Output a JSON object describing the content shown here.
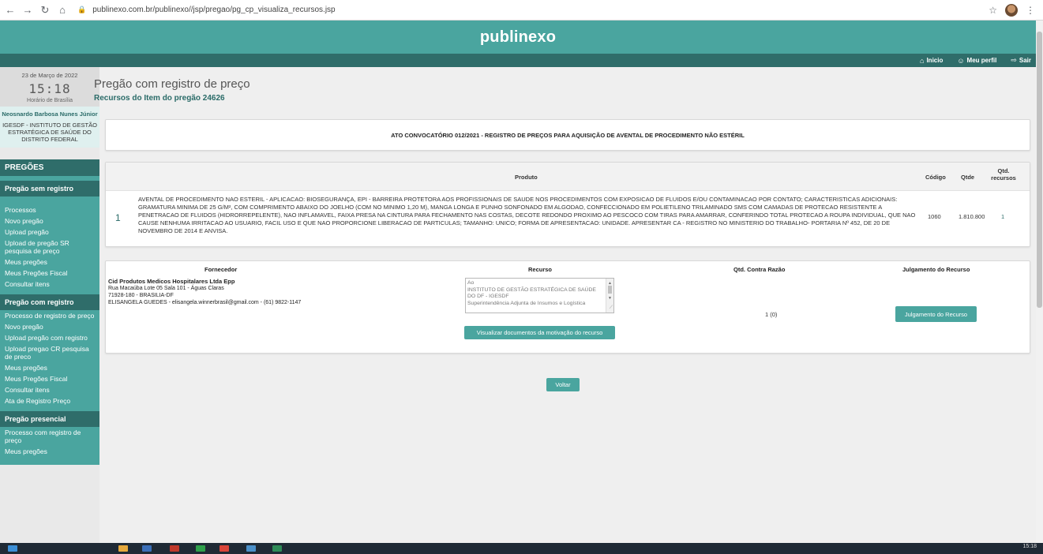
{
  "browser": {
    "url": "publinexo.com.br/publinexo//jsp/pregao/pg_cp_visualiza_recursos.jsp"
  },
  "header": {
    "logo": "publinexo",
    "nav": [
      {
        "label": "Inicio",
        "icon": "home-icon"
      },
      {
        "label": "Meu perfil",
        "icon": "user-icon"
      },
      {
        "label": "Sair",
        "icon": "logout-icon"
      }
    ]
  },
  "sidebar": {
    "date": "23 de Março de 2022",
    "time": "15:18",
    "timezone": "Horário de Brasília",
    "user_name": "Neosnardo Barbosa Nunes Júnior",
    "user_org": "IGESDF - INSTITUTO DE GESTÃO ESTRATÉGICA DE SAÚDE DO DISTRITO FEDERAL",
    "menu_title": "PREGÕES",
    "sections": [
      {
        "title": "Pregão sem registro",
        "items": [
          "Processos",
          "Novo pregão",
          "Upload pregão",
          "Upload de pregão SR pesquisa de preço",
          "Meus pregões",
          "Meus Pregões Fiscal",
          "Consultar itens"
        ]
      },
      {
        "title": "Pregão com registro",
        "items": [
          "Processo de registro de preço",
          "Novo pregão",
          "Upload pregão com registro",
          "Upload pregao CR pesquisa de preco",
          "Meus pregões",
          "Meus Pregões Fiscal",
          "Consultar itens",
          "Ata de Registro Preço"
        ]
      },
      {
        "title": "Pregão presencial",
        "items": [
          "Processo com registro de preço",
          "Meus pregões"
        ]
      }
    ]
  },
  "main": {
    "title": "Pregão com registro de preço",
    "subtitle": "Recursos do Item do pregão 24626",
    "ato": "ATO CONVOCATÓRIO 012/2021 - REGISTRO DE PREÇOS PARA AQUISIÇÃO DE AVENTAL DE PROCEDIMENTO NÃO ESTÉRIL",
    "product_table": {
      "headers": {
        "produto": "Produto",
        "codigo": "Código",
        "qtde": "Qtde",
        "qtd_recursos": "Qtd. recursos"
      },
      "row": {
        "num": "1",
        "descricao": "AVENTAL DE PROCEDIMENTO NAO ESTERIL - APLICACAO: BIOSEGURANÇA, EPI - BARREIRA PROTETORA AOS PROFISSIONAIS DE SAUDE NOS PROCEDIMENTOS COM EXPOSICAO DE FLUIDOS E/OU CONTAMINACAO POR CONTATO; CARACTERISTICAS ADICIONAIS: GRAMATURA MINIMA DE 25 G/M², COM COMPRIMENTO ABAIXO DO JOELHO (COM NO MINIMO 1,20 M), MANGA LONGA E PUNHO SONFONADO EM ALGODAO, CONFECCIONADO EM POLIETILENO TRILAMINADO SMS COM CAMADAS DE PROTECAO RESISTENTE A PENETRACAO DE FLUIDOS (HIDRORREPELENTE), NAO INFLAMAVEL, FAIXA PRESA NA CINTURA PARA FECHAMENTO NAS COSTAS, DECOTE REDONDO PROXIMO AO PESCOCO COM TIRAS PARA AMARRAR, CONFERINDO TOTAL PROTECAO A ROUPA INDIVIDUAL, QUE NAO CAUSE NENHUMA IRRITACAO AO USUARIO, FACIL USO E QUE NAO PROPORCIONE LIBERACAO DE PARTICULAS; TAMANHO: UNICO; FORMA DE APRESENTACAO: UNIDADE. APRESENTAR CA - REGISTRO NO MINISTERIO DO TRABALHO- PORTARIA Nº 452, DE 20 DE NOVEMBRO DE 2014 E ANVISA.",
        "codigo": "1060",
        "qtde": "1.810.800",
        "qtd_recursos": "1"
      }
    },
    "recurso_table": {
      "headers": {
        "fornecedor": "Fornecedor",
        "recurso": "Recurso",
        "qtd_contra_razao": "Qtd. Contra Razão",
        "julgamento": "Julgamento do Recurso"
      },
      "row": {
        "fornecedor_nome": "Cid Produtos Medicos Hospitalares Ltda Epp",
        "endereco": "Rua Macaúba Lote 05 Sala 101 - Águas Claras",
        "cep": "71928-180 - BRASILIA-DF",
        "contato": "ELISANGELA GUEDES - elisangela.winnerbrasil@gmail.com - (61) 9822-1147",
        "recurso_text": "Ao\nINSTITUTO DE GESTÃO ESTRATÉGICA DE SAÚDE DO DF - IGESDF\nSuperintendência Adjunta de Insumos e Logística",
        "visualizar_label": "Visualizar documentos da motivação do recurso",
        "qtd_contra_razao": "1 (0)",
        "julgamento_label": "Julgamento do Recurso"
      }
    },
    "voltar_label": "Voltar"
  },
  "taskbar": {
    "time": "15:18"
  },
  "colors": {
    "brand": "#4aa59f",
    "brand_dark": "#2f6d6a"
  }
}
